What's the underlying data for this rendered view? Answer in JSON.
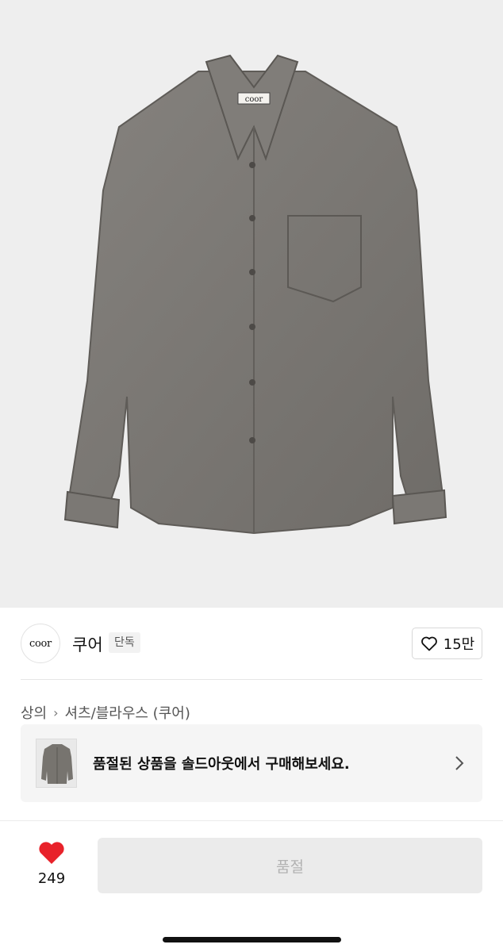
{
  "product_image": {
    "label": "coor"
  },
  "brand": {
    "logo_text": "coor",
    "name": "쿠어",
    "badge": "단독"
  },
  "like": {
    "count": "15만"
  },
  "breadcrumb": {
    "items": [
      "상의",
      "셔츠/블라우스 (쿠어)"
    ]
  },
  "soldout_banner": {
    "text": "품절된 상품을 솔드아웃에서 구매해보세요."
  },
  "bottom_bar": {
    "wish_count": "249",
    "button_label": "품절"
  },
  "colors": {
    "heart": "#e8222a",
    "shirt": "#7a7773",
    "background": "#eeeeee"
  }
}
